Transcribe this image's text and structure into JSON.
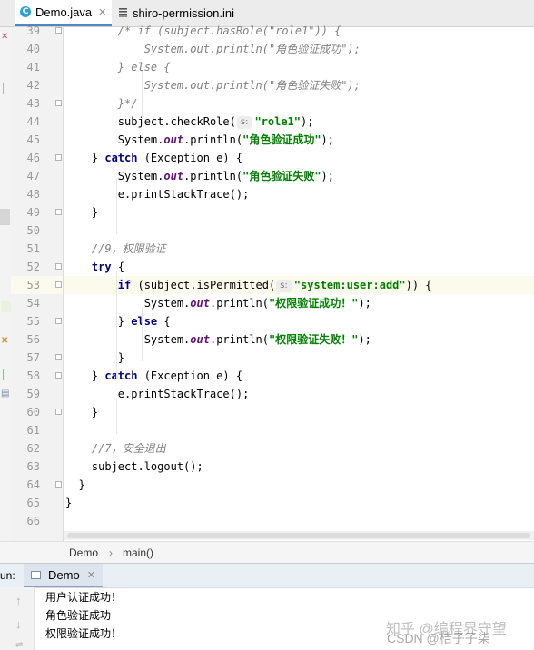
{
  "tabs": [
    {
      "label": "Demo.java",
      "icon": "java-class-icon",
      "active": true
    },
    {
      "label": "shiro-permission.ini",
      "icon": "ini-file-icon",
      "active": false
    }
  ],
  "code_lines": [
    {
      "n": "39",
      "html": "<span class=\"cmt\">        /* if (subject.hasRole(\"role1\")) {</span>"
    },
    {
      "n": "40",
      "html": "<span class=\"cmt\">            System.out.println(\"角色验证成功\");</span>"
    },
    {
      "n": "41",
      "html": "<span class=\"cmt\">        } else {</span>"
    },
    {
      "n": "42",
      "html": "<span class=\"cmt\">            System.out.println(\"角色验证失败\");</span>"
    },
    {
      "n": "43",
      "html": "<span class=\"cmt\">        }*/</span>"
    },
    {
      "n": "44",
      "html": "        subject.checkRole(<span class=\"hint\">s:</span><span class=\"str\">\"role1\"</span>);"
    },
    {
      "n": "45",
      "html": "        System.<span class=\"fld\">out</span>.println(<span class=\"str\">\"角色验证成功\"</span>);"
    },
    {
      "n": "46",
      "html": "    } <span class=\"kw\">catch</span> (Exception e) {"
    },
    {
      "n": "47",
      "html": "        System.<span class=\"fld\">out</span>.println(<span class=\"str\">\"角色验证失败\"</span>);"
    },
    {
      "n": "48",
      "html": "        e.printStackTrace();"
    },
    {
      "n": "49",
      "html": "    }"
    },
    {
      "n": "50",
      "html": ""
    },
    {
      "n": "51",
      "html": "<span class=\"cmt\">    //9，权限验证</span>"
    },
    {
      "n": "52",
      "html": "    <span class=\"kw\">try</span> {"
    },
    {
      "n": "53",
      "html": "        <span class=\"kw\">if</span> (subject.isPermitted(<span class=\"hint\">s:</span><span class=\"str\">\"system:user:add\"</span>)) {",
      "highlight": true
    },
    {
      "n": "54",
      "html": "            System.<span class=\"fld\">out</span>.println(<span class=\"str\">\"权限验证成功！\"</span>);"
    },
    {
      "n": "55",
      "html": "        } <span class=\"kw\">else</span> {"
    },
    {
      "n": "56",
      "html": "            System.<span class=\"fld\">out</span>.println(<span class=\"str\">\"权限验证失败！\"</span>);"
    },
    {
      "n": "57",
      "html": "        }"
    },
    {
      "n": "58",
      "html": "    } <span class=\"kw\">catch</span> (Exception e) {"
    },
    {
      "n": "59",
      "html": "        e.printStackTrace();"
    },
    {
      "n": "60",
      "html": "    }"
    },
    {
      "n": "61",
      "html": ""
    },
    {
      "n": "62",
      "html": "<span class=\"cmt\">    //7，安全退出</span>"
    },
    {
      "n": "63",
      "html": "    subject.logout();"
    },
    {
      "n": "64",
      "html": "  }"
    },
    {
      "n": "65",
      "html": "}"
    },
    {
      "n": "66",
      "html": ""
    }
  ],
  "breadcrumb": {
    "class_name": "Demo",
    "separator": "›",
    "method_name": "main()"
  },
  "run_panel": {
    "label": "un:",
    "tab_label": "Demo"
  },
  "console_output": [
    "用户认证成功！",
    "角色验证成功",
    "权限验证成功！"
  ],
  "watermark": {
    "line1": "知乎 @编程界守望",
    "line2": "CSDN @桔子子柒"
  }
}
